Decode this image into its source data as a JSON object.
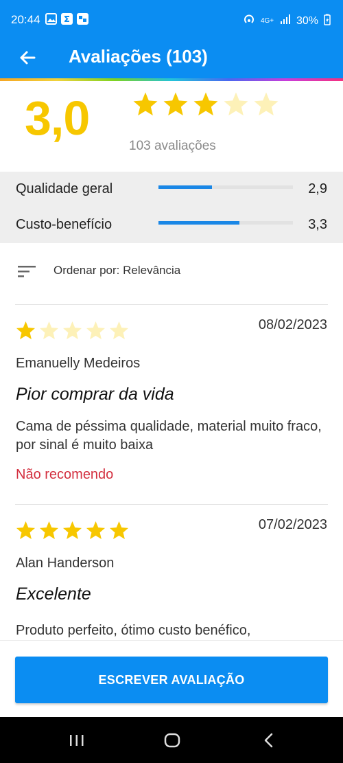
{
  "status_bar": {
    "time": "20:44",
    "network": "4G+",
    "battery": "30%"
  },
  "app_bar": {
    "title": "Avaliações (103)",
    "back_icon": "arrow-left-icon"
  },
  "summary": {
    "score": "3,0",
    "stars_filled": 3,
    "stars_total": 5,
    "count_label": "103 avaliações"
  },
  "criteria": [
    {
      "label": "Qualidade geral",
      "value": "2,9",
      "fraction": 0.4
    },
    {
      "label": "Custo-benefício",
      "value": "3,3",
      "fraction": 0.6
    }
  ],
  "sort": {
    "icon": "sort-icon",
    "label": "Ordenar por: Relevância"
  },
  "reviews": [
    {
      "rating": 1,
      "date": "08/02/2023",
      "author": "Emanuelly Medeiros",
      "title": "Pior comprar da vida",
      "body": "Cama de péssima qualidade, material muito fraco, por sinal é muito baixa",
      "recommendation": "Não recomendo"
    },
    {
      "rating": 5,
      "date": "07/02/2023",
      "author": "Alan Handerson",
      "title": "Excelente",
      "body": "Produto perfeito, ótimo custo benéfico,",
      "recommendation": ""
    }
  ],
  "actions": {
    "write_review_label": "ESCREVER AVALIAÇÃO"
  },
  "colors": {
    "primary": "#0b8df2",
    "star": "#f7c700",
    "star_empty": "#fdf1b8",
    "bar": "#1a87e6",
    "negative": "#d32f3f"
  }
}
